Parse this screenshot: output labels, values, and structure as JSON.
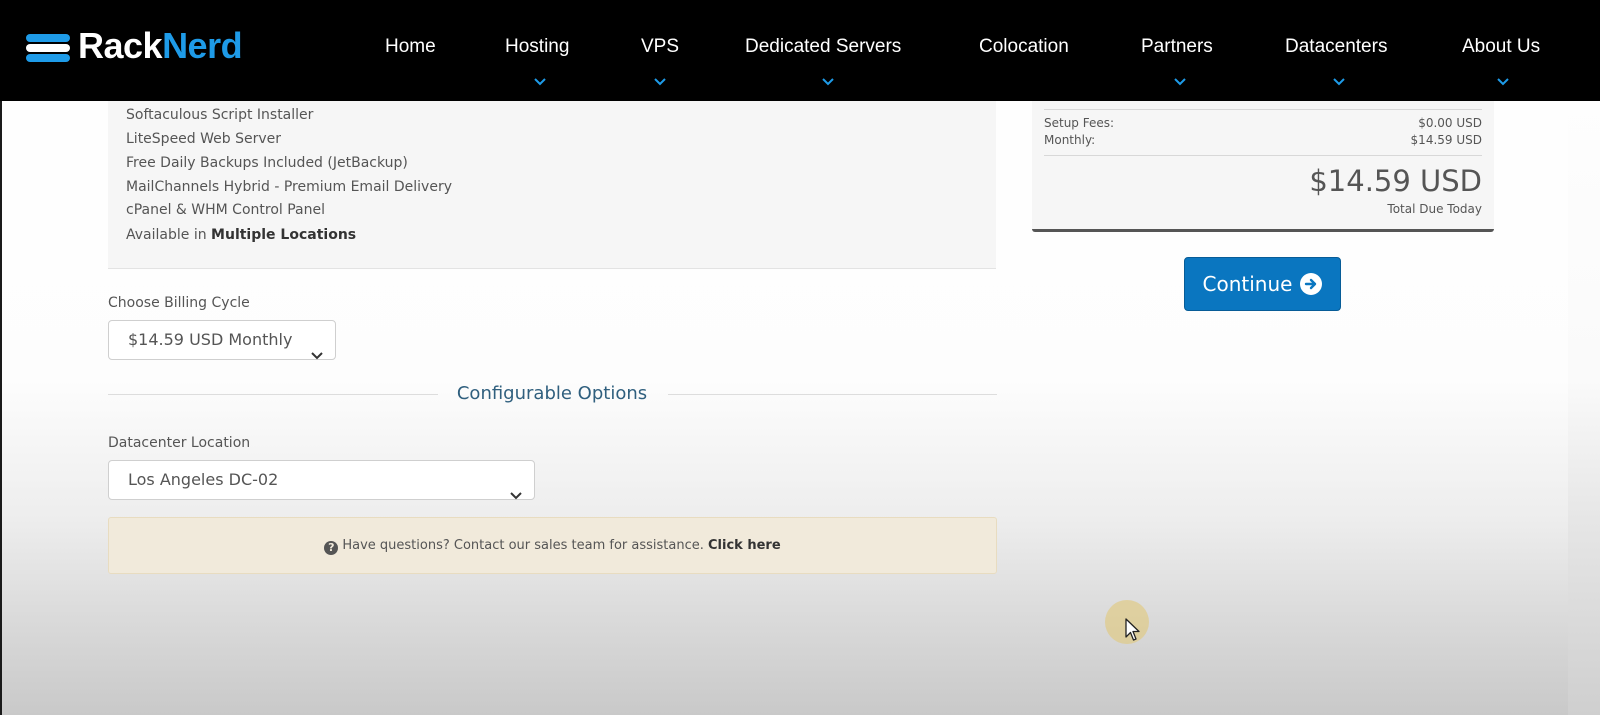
{
  "brand": {
    "name_part1": "Rack",
    "name_part2": "Nerd",
    "accent": "#1e9be8"
  },
  "nav": {
    "items": [
      {
        "label": "Home",
        "has_dropdown": false
      },
      {
        "label": "Hosting",
        "has_dropdown": true
      },
      {
        "label": "VPS",
        "has_dropdown": true
      },
      {
        "label": "Dedicated Servers",
        "has_dropdown": true
      },
      {
        "label": "Colocation",
        "has_dropdown": false
      },
      {
        "label": "Partners",
        "has_dropdown": true
      },
      {
        "label": "Datacenters",
        "has_dropdown": true
      },
      {
        "label": "About Us",
        "has_dropdown": true
      }
    ]
  },
  "product": {
    "features": [
      "Softaculous Script Installer",
      "LiteSpeed Web Server",
      "Free Daily Backups Included (JetBackup)",
      "MailChannels Hybrid - Premium Email Delivery",
      "cPanel & WHM Control Panel"
    ],
    "availability_prefix": "Available in",
    "availability_bold": "Multiple Locations"
  },
  "billing": {
    "label": "Choose Billing Cycle",
    "selected": "$14.59 USD Monthly"
  },
  "configurable": {
    "title": "Configurable Options",
    "datacenter_label": "Datacenter Location",
    "datacenter_selected": "Los Angeles DC-02"
  },
  "contact": {
    "text": "Have questions? Contact our sales team for assistance.",
    "link": "Click here"
  },
  "summary": {
    "setup_fees_label": "Setup Fees:",
    "setup_fees_value": "$0.00 USD",
    "monthly_label": "Monthly:",
    "monthly_value": "$14.59 USD",
    "total": "$14.59 USD",
    "total_label": "Total Due Today"
  },
  "actions": {
    "continue_label": "Continue"
  },
  "colors": {
    "primary_button": "#0a76c0",
    "section_title": "#2f5f7e",
    "contact_bg": "#f1eadb"
  }
}
